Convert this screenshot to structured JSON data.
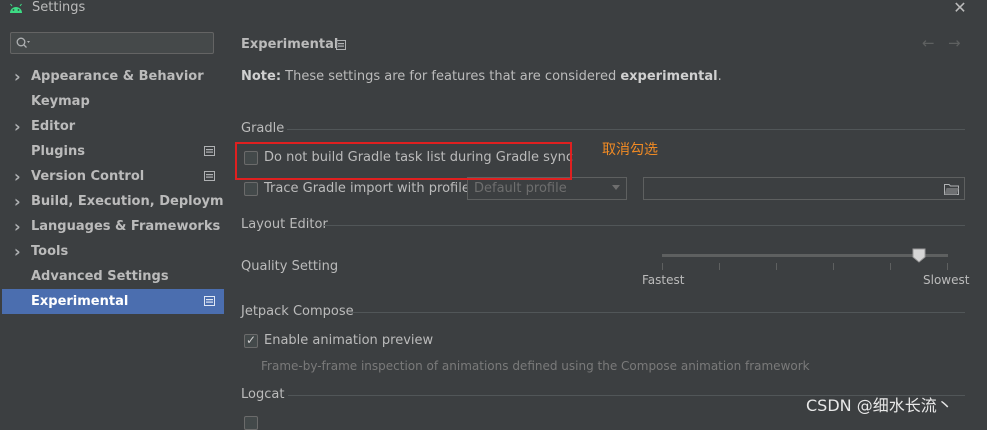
{
  "window": {
    "title": "Settings"
  },
  "search": {
    "placeholder": ""
  },
  "sidebar": {
    "items": [
      {
        "label": "Appearance & Behavior",
        "expandable": true,
        "page_icon": false,
        "selected": false
      },
      {
        "label": "Keymap",
        "expandable": false,
        "page_icon": false,
        "selected": false
      },
      {
        "label": "Editor",
        "expandable": true,
        "page_icon": false,
        "selected": false
      },
      {
        "label": "Plugins",
        "expandable": false,
        "page_icon": true,
        "selected": false
      },
      {
        "label": "Version Control",
        "expandable": true,
        "page_icon": true,
        "selected": false
      },
      {
        "label": "Build, Execution, Deployment",
        "expandable": true,
        "page_icon": false,
        "selected": false
      },
      {
        "label": "Languages & Frameworks",
        "expandable": true,
        "page_icon": false,
        "selected": false
      },
      {
        "label": "Tools",
        "expandable": true,
        "page_icon": false,
        "selected": false
      },
      {
        "label": "Advanced Settings",
        "expandable": false,
        "page_icon": false,
        "selected": false
      },
      {
        "label": "Experimental",
        "expandable": false,
        "page_icon": true,
        "selected": true
      }
    ]
  },
  "main": {
    "title": "Experimental",
    "note_prefix": "Note:",
    "note_text": " These settings are for features that are considered ",
    "note_emphasis": "experimental",
    "note_suffix": ".",
    "gradle": {
      "heading": "Gradle",
      "no_build_task_list": {
        "label": "Do not build Gradle task list during Gradle sync",
        "checked": false
      },
      "trace_import": {
        "label": "Trace Gradle import with profile:",
        "checked": false
      },
      "profile_dropdown": "Default profile",
      "profile_path": ""
    },
    "layout_editor": {
      "heading": "Layout Editor",
      "quality_label": "Quality Setting",
      "min_label": "Fastest",
      "max_label": "Slowest",
      "quality_level": 0.9
    },
    "compose": {
      "heading": "Jetpack Compose",
      "animation_preview": {
        "label": "Enable animation preview",
        "checked": true
      },
      "description": "Frame-by-frame inspection of animations defined using the Compose animation framework"
    },
    "logcat": {
      "heading": "Logcat"
    }
  },
  "annotation": {
    "text": "取消勾选",
    "color": "#f08a24"
  },
  "watermark": "CSDN @细水长流丶",
  "colors": {
    "selection": "#4b6eaf",
    "background": "#3c3f41",
    "highlight_box": "#e02020"
  }
}
